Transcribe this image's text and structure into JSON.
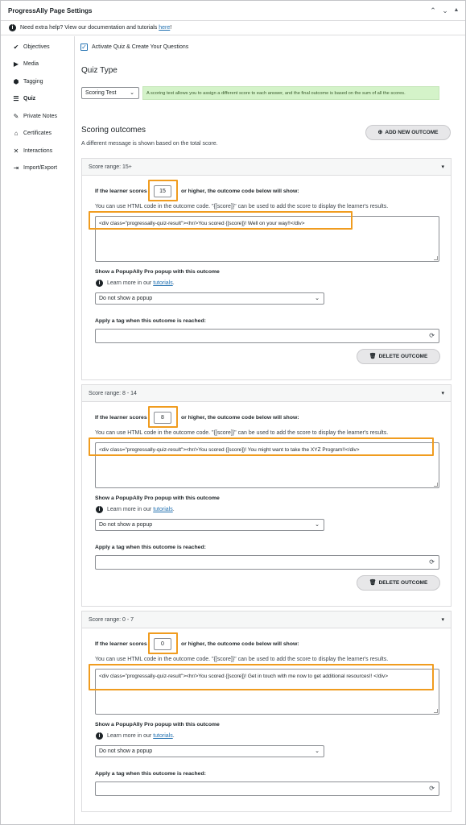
{
  "app": {
    "title": "ProgressAlly Page Settings",
    "header_controls": {
      "up": "⌃",
      "down": "⌄",
      "collapse": "▲"
    },
    "help": {
      "text": "Need extra help? View our documentation and tutorials ",
      "link": "here",
      "suffix": "!"
    }
  },
  "sidebar": {
    "items": [
      {
        "label": "Objectives",
        "icon": "check-circle-icon",
        "glyph": "✔"
      },
      {
        "label": "Media",
        "icon": "media-play-icon",
        "glyph": "▶"
      },
      {
        "label": "Tagging",
        "icon": "tag-icon",
        "glyph": "⬢"
      },
      {
        "label": "Quiz",
        "icon": "list-icon",
        "glyph": "☰"
      },
      {
        "label": "Private Notes",
        "icon": "chat-icon",
        "glyph": "✎"
      },
      {
        "label": "Certificates",
        "icon": "graduation-cap-icon",
        "glyph": "⌂"
      },
      {
        "label": "Interactions",
        "icon": "interactions-icon",
        "glyph": "✕"
      },
      {
        "label": "Import/Export",
        "icon": "import-export-icon",
        "glyph": "⇥"
      }
    ],
    "active_index": 3
  },
  "main": {
    "activate_label": "Activate Quiz & Create Your Questions",
    "activate_checked": true,
    "quiz_type_heading": "Quiz Type",
    "quiz_type_value": "Scoring Test",
    "quiz_type_info": "A scoring test allows you to assign a different score to each answer, and the final outcome is based on the sum of all the scores.",
    "scoring_heading": "Scoring outcomes",
    "scoring_desc": "A different message is shown based on the total score.",
    "add_outcome_label": "ADD NEW OUTCOME",
    "outcomes": [
      {
        "range": "Score range: 15+",
        "score": "15",
        "code": "<div class=\"progressally-quiz-result\"><hr/>You scored {[score]}! Well on your way!!</div>"
      },
      {
        "range": "Score range: 8 - 14",
        "score": "8",
        "code": "<div class=\"progressally-quiz-result\"><hr/>You scored {[score]}! You might want to take the XYZ Program!!</div>"
      },
      {
        "range": "Score range: 0 - 7",
        "score": "0",
        "code": "<div class=\"progressally-quiz-result\"><hr/>You scored {[score]}! Get in touch with me now to get additional resources!! </div>"
      }
    ],
    "outcome_labels": {
      "if_score_pre": "If the learner scores",
      "if_score_post": "or higher, the outcome code below will show:",
      "html_help": "You can use HTML code in the outcome code. \"{[score]}\" can be used to add the score to display the learner's results.",
      "popup_label": "Show a PopupAlly Pro popup with this outcome",
      "learn_more": "Learn more in our ",
      "tutorials": "tutorials",
      "popup_value": "Do not show a popup",
      "tag_label": "Apply a tag when this outcome is reached:",
      "delete_label": "DELETE OUTCOME"
    }
  },
  "colors": {
    "highlight": "#f09c1f",
    "info_bg": "#d4f3c9",
    "link": "#2271b1"
  }
}
